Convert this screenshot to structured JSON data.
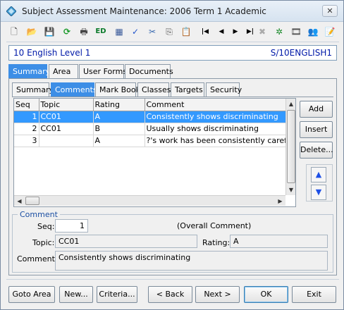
{
  "window": {
    "title": "Subject Assessment Maintenance:  2006 Term 1 Academic",
    "close_glyph": "✕"
  },
  "toolbar": {
    "icons": [
      "new-document-icon",
      "open-folder-icon",
      "save-icon",
      "refresh-icon",
      "print-icon",
      "export-icon",
      "calculator-icon",
      "spellcheck-icon",
      "cut-icon",
      "copy-icon",
      "paste-icon",
      "first-record-icon",
      "previous-record-icon",
      "next-record-icon",
      "last-record-icon",
      "delete-icon",
      "settings-icon",
      "film-icon",
      "people-icon",
      "report-icon"
    ],
    "glyphs": [
      "🗋",
      "📂",
      "💾",
      "⟳",
      "🖶",
      "ED",
      "▦",
      "✓",
      "✂",
      "⎘",
      "📋",
      "|◀",
      "◀",
      "▶",
      "▶|",
      "✖",
      "✲",
      "🎞",
      "👥",
      "📝"
    ]
  },
  "header": {
    "subject_name": "10 English Level 1",
    "subject_code": "S/10ENGLISH1"
  },
  "main_tabs": [
    "Summary",
    "Area",
    "User Forms",
    "Documents"
  ],
  "sub_tabs": [
    "Summary",
    "Comments",
    "Mark Book",
    "Classes",
    "Targets",
    "Security"
  ],
  "grid": {
    "columns": [
      "Seq",
      "Topic",
      "Rating",
      "Comment"
    ],
    "rows": [
      {
        "seq": "1",
        "topic": "CC01",
        "rating": "A",
        "comment": "Consistently shows discriminating"
      },
      {
        "seq": "2",
        "topic": "CC01",
        "rating": "B",
        "comment": "Usually shows discriminating"
      },
      {
        "seq": "3",
        "topic": "",
        "rating": "A",
        "comment": "?'s work has been consistently careful"
      }
    ]
  },
  "side_buttons": {
    "add": "Add",
    "insert": "Insert",
    "delete": "Delete..."
  },
  "detail": {
    "legend": "Comment",
    "seq_label": "Seq:",
    "seq_value": "1",
    "overall_label": "(Overall Comment)",
    "topic_label": "Topic:",
    "topic_value": "CC01",
    "rating_label": "Rating:",
    "rating_value": "A",
    "comment_label": "Comment:",
    "comment_value": "Consistently shows discriminating"
  },
  "footer": {
    "goto_area": "Goto Area",
    "new": "New...",
    "criteria": "Criteria...",
    "back": "< Back",
    "next": "Next >",
    "ok": "OK",
    "exit": "Exit"
  },
  "colors": {
    "selection": "#3399ff",
    "active_tab": "#3d8ee6",
    "header_text": "#0019a8",
    "arrow_blue": "#1e50e6"
  }
}
